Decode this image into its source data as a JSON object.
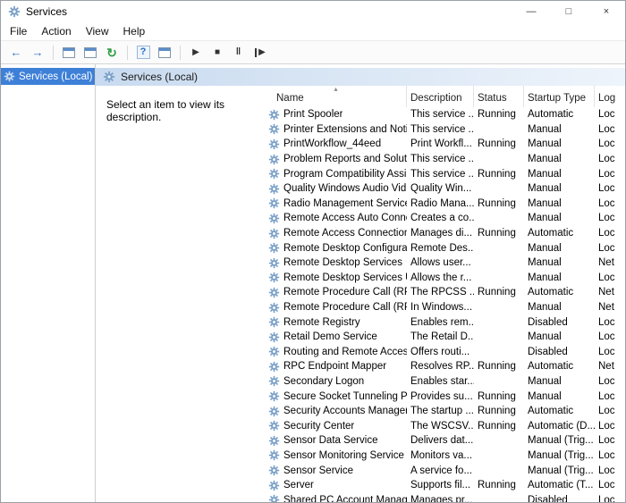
{
  "window": {
    "title": "Services",
    "minimize_glyph": "—",
    "maximize_glyph": "□",
    "close_glyph": "×"
  },
  "menu": {
    "items": [
      "File",
      "Action",
      "View",
      "Help"
    ]
  },
  "toolbar": {
    "buttons": [
      {
        "name": "back",
        "glyph": "←",
        "cls": "g-blue"
      },
      {
        "name": "forward",
        "glyph": "→",
        "cls": "g-blue"
      },
      {
        "sep": true
      },
      {
        "name": "show-console-tree",
        "icon": "window"
      },
      {
        "name": "properties",
        "icon": "window"
      },
      {
        "name": "refresh",
        "glyph": "↻",
        "cls": "g-green"
      },
      {
        "sep": true
      },
      {
        "name": "help",
        "glyph": "?",
        "cls": "g-help"
      },
      {
        "name": "export-list",
        "icon": "window"
      },
      {
        "sep": true
      },
      {
        "name": "start-service",
        "glyph": "▶",
        "cls": "g-dark"
      },
      {
        "name": "stop-service",
        "glyph": "■",
        "cls": "g-dark"
      },
      {
        "name": "pause-service",
        "glyph": "‖",
        "cls": "g-dark g-pause"
      },
      {
        "name": "restart-service",
        "glyph": "▶",
        "cls": "g-dark g-restart"
      }
    ]
  },
  "sidebar": {
    "selected_item": "Services (Local)"
  },
  "main": {
    "header": "Services (Local)",
    "description_panel": "Select an item to view its description.",
    "table": {
      "columns": [
        "Name",
        "Description",
        "Status",
        "Startup Type",
        "Log"
      ],
      "rows": [
        {
          "name": "Print Spooler",
          "description": "This service ...",
          "status": "Running",
          "startup_type": "Automatic",
          "log_on_as": "Loc"
        },
        {
          "name": "Printer Extensions and Notif...",
          "description": "This service ...",
          "status": "",
          "startup_type": "Manual",
          "log_on_as": "Loc"
        },
        {
          "name": "PrintWorkflow_44eed",
          "description": "Print Workfl...",
          "status": "Running",
          "startup_type": "Manual",
          "log_on_as": "Loc"
        },
        {
          "name": "Problem Reports and Soluti...",
          "description": "This service ...",
          "status": "",
          "startup_type": "Manual",
          "log_on_as": "Loc"
        },
        {
          "name": "Program Compatibility Assi...",
          "description": "This service ...",
          "status": "Running",
          "startup_type": "Manual",
          "log_on_as": "Loc"
        },
        {
          "name": "Quality Windows Audio Vid...",
          "description": "Quality Win...",
          "status": "",
          "startup_type": "Manual",
          "log_on_as": "Loc"
        },
        {
          "name": "Radio Management Service",
          "description": "Radio Mana...",
          "status": "Running",
          "startup_type": "Manual",
          "log_on_as": "Loc"
        },
        {
          "name": "Remote Access Auto Conne...",
          "description": "Creates a co...",
          "status": "",
          "startup_type": "Manual",
          "log_on_as": "Loc"
        },
        {
          "name": "Remote Access Connection...",
          "description": "Manages di...",
          "status": "Running",
          "startup_type": "Automatic",
          "log_on_as": "Loc"
        },
        {
          "name": "Remote Desktop Configurat...",
          "description": "Remote Des...",
          "status": "",
          "startup_type": "Manual",
          "log_on_as": "Loc"
        },
        {
          "name": "Remote Desktop Services",
          "description": "Allows user...",
          "status": "",
          "startup_type": "Manual",
          "log_on_as": "Net"
        },
        {
          "name": "Remote Desktop Services U...",
          "description": "Allows the r...",
          "status": "",
          "startup_type": "Manual",
          "log_on_as": "Loc"
        },
        {
          "name": "Remote Procedure Call (RPC)",
          "description": "The RPCSS ...",
          "status": "Running",
          "startup_type": "Automatic",
          "log_on_as": "Net"
        },
        {
          "name": "Remote Procedure Call (RP...",
          "description": "In Windows...",
          "status": "",
          "startup_type": "Manual",
          "log_on_as": "Net"
        },
        {
          "name": "Remote Registry",
          "description": "Enables rem...",
          "status": "",
          "startup_type": "Disabled",
          "log_on_as": "Loc"
        },
        {
          "name": "Retail Demo Service",
          "description": "The Retail D...",
          "status": "",
          "startup_type": "Manual",
          "log_on_as": "Loc"
        },
        {
          "name": "Routing and Remote Access",
          "description": "Offers routi...",
          "status": "",
          "startup_type": "Disabled",
          "log_on_as": "Loc"
        },
        {
          "name": "RPC Endpoint Mapper",
          "description": "Resolves RP...",
          "status": "Running",
          "startup_type": "Automatic",
          "log_on_as": "Net"
        },
        {
          "name": "Secondary Logon",
          "description": "Enables star...",
          "status": "",
          "startup_type": "Manual",
          "log_on_as": "Loc"
        },
        {
          "name": "Secure Socket Tunneling Pr...",
          "description": "Provides su...",
          "status": "Running",
          "startup_type": "Manual",
          "log_on_as": "Loc"
        },
        {
          "name": "Security Accounts Manager",
          "description": "The startup ...",
          "status": "Running",
          "startup_type": "Automatic",
          "log_on_as": "Loc"
        },
        {
          "name": "Security Center",
          "description": "The WSCSV...",
          "status": "Running",
          "startup_type": "Automatic (D...",
          "log_on_as": "Loc"
        },
        {
          "name": "Sensor Data Service",
          "description": "Delivers dat...",
          "status": "",
          "startup_type": "Manual (Trig...",
          "log_on_as": "Loc"
        },
        {
          "name": "Sensor Monitoring Service",
          "description": "Monitors va...",
          "status": "",
          "startup_type": "Manual (Trig...",
          "log_on_as": "Loc"
        },
        {
          "name": "Sensor Service",
          "description": "A service fo...",
          "status": "",
          "startup_type": "Manual (Trig...",
          "log_on_as": "Loc"
        },
        {
          "name": "Server",
          "description": "Supports fil...",
          "status": "Running",
          "startup_type": "Automatic (T...",
          "log_on_as": "Loc"
        },
        {
          "name": "Shared PC Account Manager",
          "description": "Manages pr...",
          "status": "",
          "startup_type": "Disabled",
          "log_on_as": "Loc"
        }
      ]
    }
  },
  "icons": {
    "sort_ascending": "▴"
  },
  "colors": {
    "selection_blue": "#3e80d8",
    "header_gradient_start": "#c8daef",
    "header_gradient_end": "#eef4fb",
    "gear_icon": "#7aa0c8"
  }
}
